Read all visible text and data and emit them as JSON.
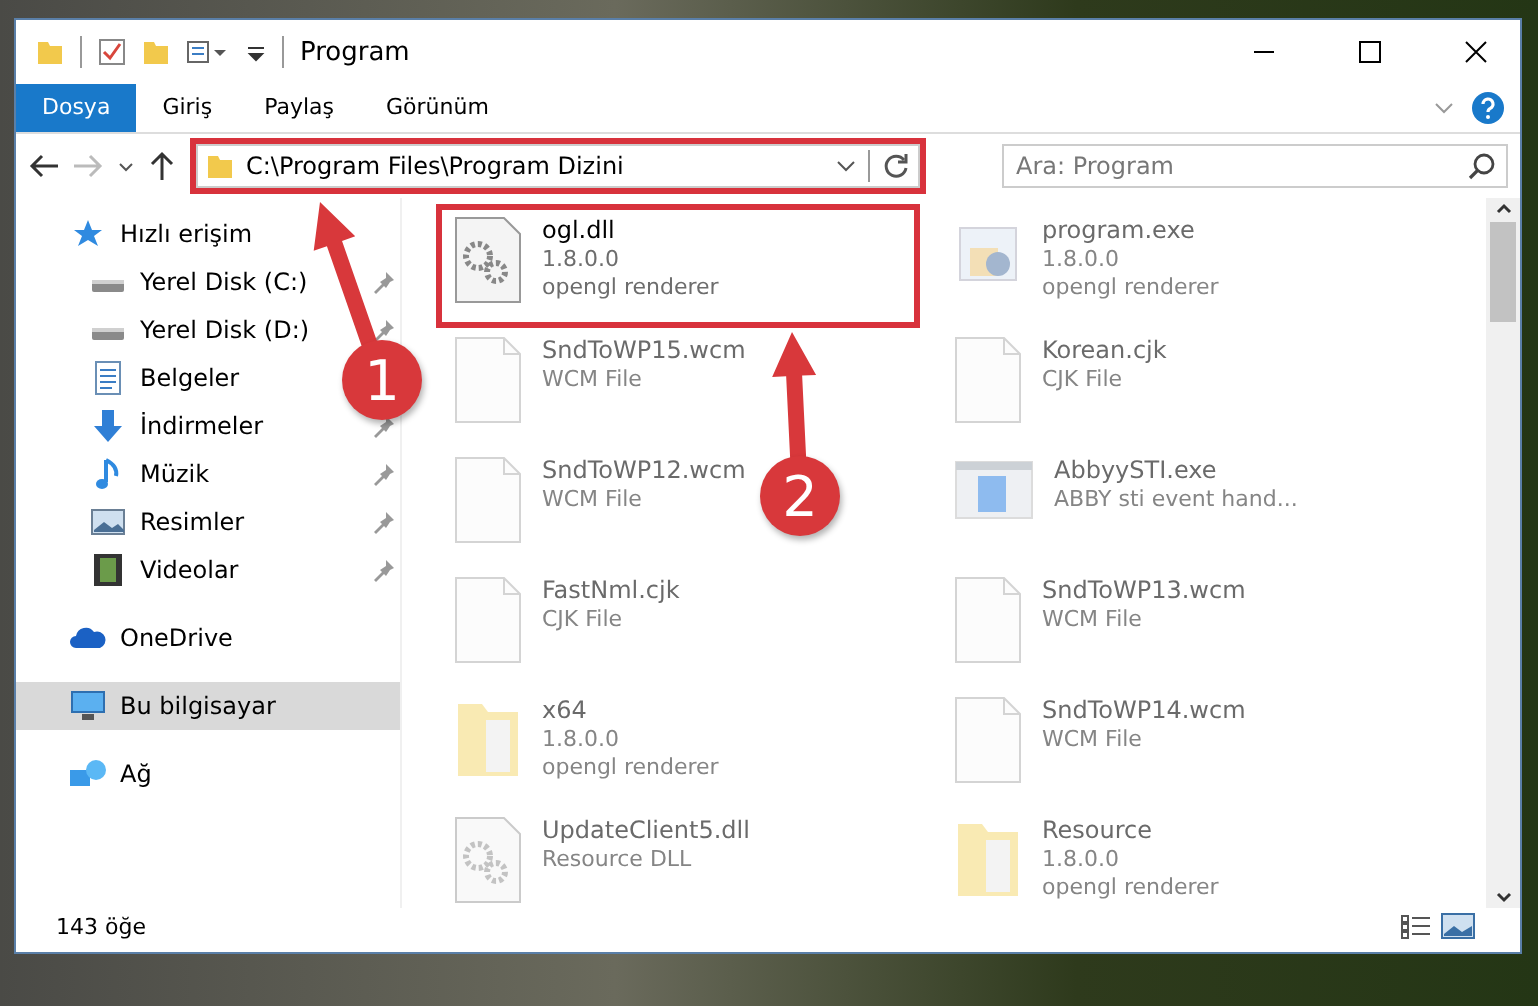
{
  "window": {
    "title": "Program"
  },
  "ribbon_tabs": [
    {
      "label": "Dosya",
      "selected": true
    },
    {
      "label": "Giriş",
      "selected": false
    },
    {
      "label": "Paylaş",
      "selected": false
    },
    {
      "label": "Görünüm",
      "selected": false
    }
  ],
  "address_bar": {
    "path": "C:\\Program Files\\Program Dizini",
    "highlighted": true
  },
  "search": {
    "placeholder": "Ara: Program"
  },
  "sidebar": {
    "items": [
      {
        "label": "Hızlı erişim",
        "kind": "star",
        "selected": false,
        "children": [
          {
            "label": "Yerel Disk (C:)",
            "kind": "drive",
            "pinned": true,
            "selected": false
          },
          {
            "label": "Yerel Disk (D:)",
            "kind": "drive",
            "pinned": true,
            "selected": false
          },
          {
            "label": "Belgeler",
            "kind": "document",
            "pinned": false,
            "selected": false
          },
          {
            "label": "İndirmeler",
            "kind": "download",
            "pinned": true,
            "selected": false
          },
          {
            "label": "Müzik",
            "kind": "music",
            "pinned": true,
            "selected": false
          },
          {
            "label": "Resimler",
            "kind": "picture",
            "pinned": true,
            "selected": false
          },
          {
            "label": "Videolar",
            "kind": "video",
            "pinned": true,
            "selected": false
          }
        ]
      },
      {
        "label": "OneDrive",
        "kind": "cloud",
        "selected": false
      },
      {
        "label": "Bu bilgisayar",
        "kind": "computer",
        "selected": true
      },
      {
        "label": "Ağ",
        "kind": "network",
        "selected": false
      }
    ]
  },
  "files": [
    {
      "name": "ogl.dll",
      "kind": "gear",
      "lines": [
        "1.8.0.0",
        "opengl renderer"
      ],
      "highlighted": true,
      "dimmed": false
    },
    {
      "name": "program.exe",
      "kind": "exe",
      "lines": [
        "1.8.0.0",
        "opengl renderer"
      ],
      "highlighted": false,
      "dimmed": true
    },
    {
      "name": "SndToWP15.wcm",
      "kind": "blank",
      "lines": [
        "WCM File"
      ],
      "highlighted": false,
      "dimmed": true
    },
    {
      "name": "Korean.cjk",
      "kind": "blank",
      "lines": [
        "CJK File"
      ],
      "highlighted": false,
      "dimmed": true
    },
    {
      "name": "SndToWP12.wcm",
      "kind": "blank",
      "lines": [
        "WCM File"
      ],
      "highlighted": false,
      "dimmed": true
    },
    {
      "name": "AbbyySTI.exe",
      "kind": "window",
      "lines": [
        "ABBY sti event hand..."
      ],
      "highlighted": false,
      "dimmed": true
    },
    {
      "name": "FastNml.cjk",
      "kind": "blank",
      "lines": [
        "CJK File"
      ],
      "highlighted": false,
      "dimmed": true
    },
    {
      "name": "SndToWP13.wcm",
      "kind": "blank",
      "lines": [
        "WCM File"
      ],
      "highlighted": false,
      "dimmed": true
    },
    {
      "name": "x64",
      "kind": "folder",
      "lines": [
        "1.8.0.0",
        "opengl renderer"
      ],
      "highlighted": false,
      "dimmed": true
    },
    {
      "name": "SndToWP14.wcm",
      "kind": "blank",
      "lines": [
        "WCM File"
      ],
      "highlighted": false,
      "dimmed": true
    },
    {
      "name": "UpdateClient5.dll",
      "kind": "gear",
      "lines": [
        "Resource DLL"
      ],
      "highlighted": false,
      "dimmed": true
    },
    {
      "name": "Resource",
      "kind": "folder",
      "lines": [
        "1.8.0.0",
        "opengl renderer"
      ],
      "highlighted": false,
      "dimmed": true
    }
  ],
  "status_bar": {
    "item_count": "143 öğe"
  },
  "annotations": [
    {
      "number": "1"
    },
    {
      "number": "2"
    }
  ]
}
